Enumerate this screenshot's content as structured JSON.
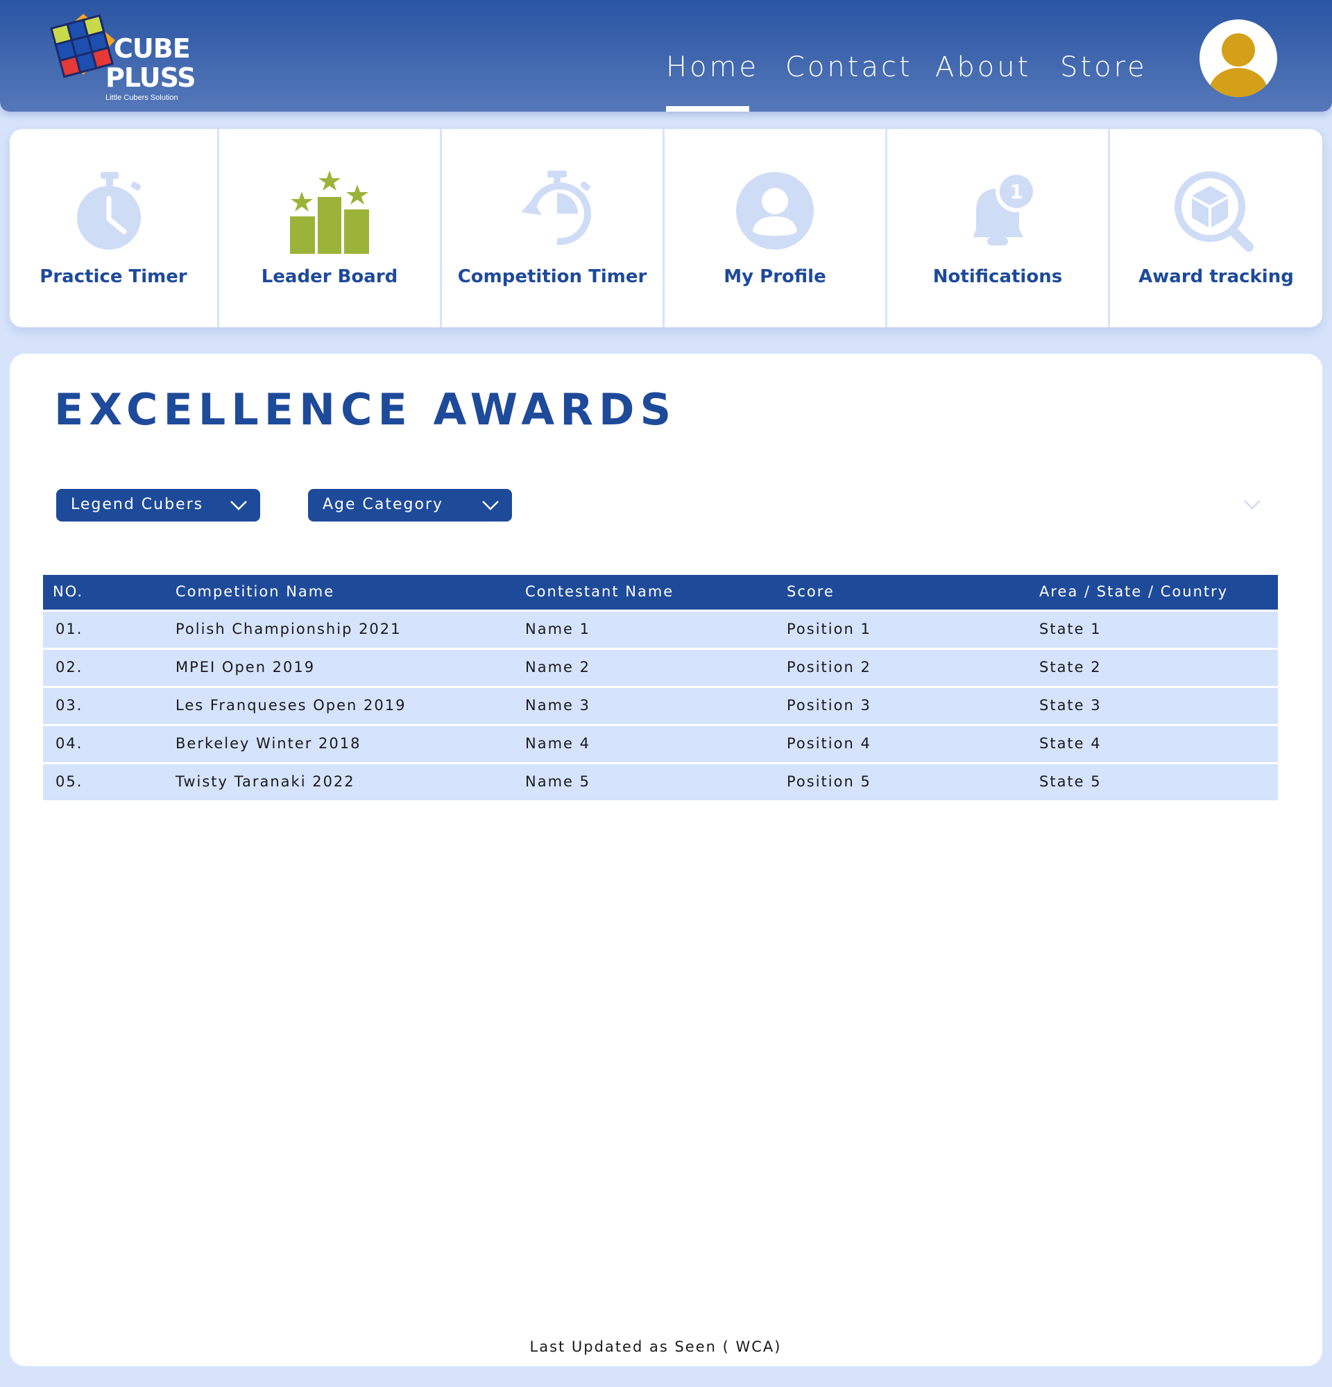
{
  "header": {
    "logo_line1": "CUBE",
    "logo_line2": "PLUSS",
    "logo_tagline": "Little Cubers Solution",
    "nav": [
      {
        "label": "Home",
        "active": true
      },
      {
        "label": "Contact",
        "active": false
      },
      {
        "label": "About",
        "active": false
      },
      {
        "label": "Store",
        "active": false
      }
    ],
    "avatar_icon": "user-avatar-icon"
  },
  "features": [
    {
      "label": "Practice Timer",
      "icon": "stopwatch-icon"
    },
    {
      "label": "Leader Board",
      "icon": "podium-stars-icon"
    },
    {
      "label": "Competition Timer",
      "icon": "timer-reset-icon"
    },
    {
      "label": "My Profile",
      "icon": "profile-icon"
    },
    {
      "label": "Notifications",
      "icon": "bell-badge-icon"
    },
    {
      "label": "Award tracking",
      "icon": "cube-search-icon"
    }
  ],
  "main": {
    "title": "EXCELLENCE AWARDS",
    "filters": [
      {
        "label": "Legend Cubers"
      },
      {
        "label": "Age Category"
      }
    ],
    "table": {
      "headers": [
        "NO.",
        "Competition Name",
        "Contestant Name",
        "Score",
        "Area / State / Country"
      ],
      "rows": [
        [
          "01.",
          "Polish Championship 2021",
          "Name 1",
          "Position 1",
          "State 1"
        ],
        [
          "02.",
          "MPEI Open 2019",
          "Name 2",
          "Position 2",
          "State 2"
        ],
        [
          "03.",
          "Les Franqueses Open 2019",
          "Name 3",
          "Position 3",
          "State 3"
        ],
        [
          "04.",
          "Berkeley Winter 2018",
          "Name 4",
          "Position 4",
          "State 4"
        ],
        [
          "05.",
          "Twisty Taranaki 2022",
          "Name 5",
          "Position 5",
          "State 5"
        ]
      ]
    },
    "footer_note": "Last Updated as Seen ( WCA)"
  },
  "colors": {
    "brand_blue": "#1e4a9a",
    "icon_light_blue": "#cfdcf6",
    "leaderboard_green": "#9cb33a",
    "avatar_gold": "#d4a017",
    "row_bg": "#d5e3fc",
    "page_bg": "#d6e3fb"
  }
}
